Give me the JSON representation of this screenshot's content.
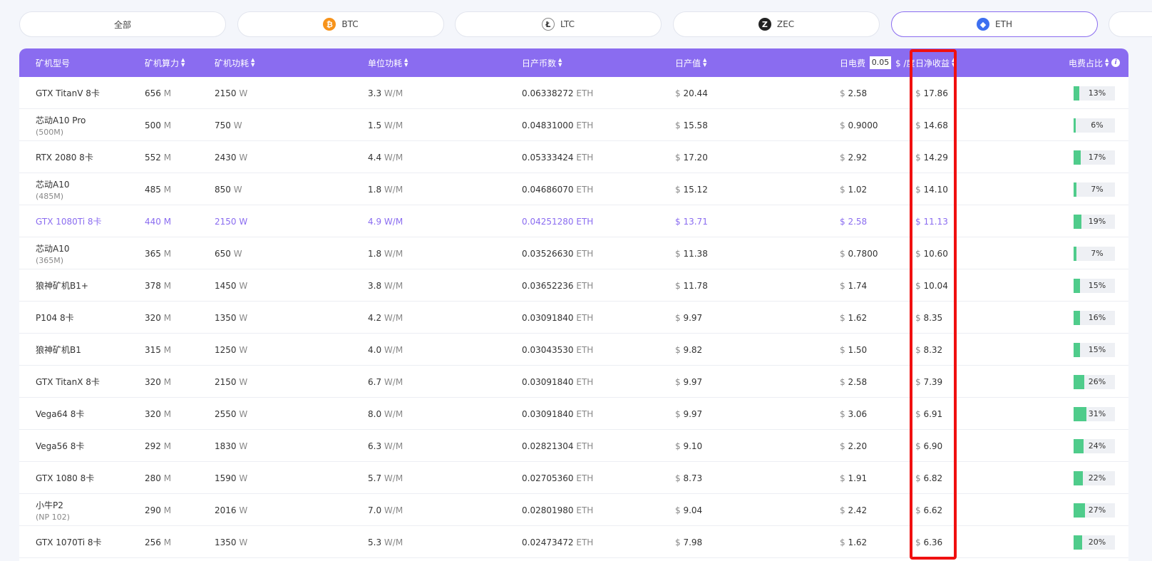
{
  "tabs": [
    {
      "label": "全部",
      "icon": null,
      "icon_glyph": ""
    },
    {
      "label": "BTC",
      "icon": "btc-icon",
      "icon_glyph": "₿"
    },
    {
      "label": "LTC",
      "icon": "ltc-icon",
      "icon_glyph": "Ł"
    },
    {
      "label": "ZEC",
      "icon": "zec-icon",
      "icon_glyph": "Z"
    },
    {
      "label": "ETH",
      "icon": "eth-icon",
      "icon_glyph": "◆"
    }
  ],
  "active_tab": "ETH",
  "header": {
    "model": "矿机型号",
    "hashrate": "矿机算力",
    "power": "矿机功耗",
    "efficiency": "单位功耗",
    "daily_coins": "日产币数",
    "daily_value": "日产值",
    "fee_label": "日电费",
    "fee_value": "0.05",
    "fee_unit": "$ /度",
    "net_income": "日净收益",
    "fee_ratio": "电费占比"
  },
  "colors": {
    "accent": "#8a6cf0",
    "bar": "#4fcc8b",
    "highlight_box": "#f01010"
  },
  "rows": [
    {
      "model": "GTX TitanV 8卡",
      "sub": "",
      "hash": "656",
      "hash_unit": "M",
      "power": "2150",
      "power_unit": "W",
      "eff": "3.3",
      "eff_unit": "W/M",
      "coins": "0.06338272",
      "coin_unit": "ETH",
      "value": "20.44",
      "fee": "2.58",
      "net": "17.86",
      "ratio": 13
    },
    {
      "model": "芯动A10 Pro",
      "sub": "(500M)",
      "hash": "500",
      "hash_unit": "M",
      "power": "750",
      "power_unit": "W",
      "eff": "1.5",
      "eff_unit": "W/M",
      "coins": "0.04831000",
      "coin_unit": "ETH",
      "value": "15.58",
      "fee": "0.9000",
      "net": "14.68",
      "ratio": 6
    },
    {
      "model": "RTX 2080 8卡",
      "sub": "",
      "hash": "552",
      "hash_unit": "M",
      "power": "2430",
      "power_unit": "W",
      "eff": "4.4",
      "eff_unit": "W/M",
      "coins": "0.05333424",
      "coin_unit": "ETH",
      "value": "17.20",
      "fee": "2.92",
      "net": "14.29",
      "ratio": 17
    },
    {
      "model": "芯动A10",
      "sub": "(485M)",
      "hash": "485",
      "hash_unit": "M",
      "power": "850",
      "power_unit": "W",
      "eff": "1.8",
      "eff_unit": "W/M",
      "coins": "0.04686070",
      "coin_unit": "ETH",
      "value": "15.12",
      "fee": "1.02",
      "net": "14.10",
      "ratio": 7
    },
    {
      "model": "GTX 1080Ti 8卡",
      "sub": "",
      "hash": "440",
      "hash_unit": "M",
      "power": "2150",
      "power_unit": "W",
      "eff": "4.9",
      "eff_unit": "W/M",
      "coins": "0.04251280",
      "coin_unit": "ETH",
      "value": "13.71",
      "fee": "2.58",
      "net": "11.13",
      "ratio": 19,
      "highlight": true
    },
    {
      "model": "芯动A10",
      "sub": "(365M)",
      "hash": "365",
      "hash_unit": "M",
      "power": "650",
      "power_unit": "W",
      "eff": "1.8",
      "eff_unit": "W/M",
      "coins": "0.03526630",
      "coin_unit": "ETH",
      "value": "11.38",
      "fee": "0.7800",
      "net": "10.60",
      "ratio": 7
    },
    {
      "model": "狼神矿机B1+",
      "sub": "",
      "hash": "378",
      "hash_unit": "M",
      "power": "1450",
      "power_unit": "W",
      "eff": "3.8",
      "eff_unit": "W/M",
      "coins": "0.03652236",
      "coin_unit": "ETH",
      "value": "11.78",
      "fee": "1.74",
      "net": "10.04",
      "ratio": 15
    },
    {
      "model": "P104 8卡",
      "sub": "",
      "hash": "320",
      "hash_unit": "M",
      "power": "1350",
      "power_unit": "W",
      "eff": "4.2",
      "eff_unit": "W/M",
      "coins": "0.03091840",
      "coin_unit": "ETH",
      "value": "9.97",
      "fee": "1.62",
      "net": "8.35",
      "ratio": 16
    },
    {
      "model": "狼神矿机B1",
      "sub": "",
      "hash": "315",
      "hash_unit": "M",
      "power": "1250",
      "power_unit": "W",
      "eff": "4.0",
      "eff_unit": "W/M",
      "coins": "0.03043530",
      "coin_unit": "ETH",
      "value": "9.82",
      "fee": "1.50",
      "net": "8.32",
      "ratio": 15
    },
    {
      "model": "GTX TitanX 8卡",
      "sub": "",
      "hash": "320",
      "hash_unit": "M",
      "power": "2150",
      "power_unit": "W",
      "eff": "6.7",
      "eff_unit": "W/M",
      "coins": "0.03091840",
      "coin_unit": "ETH",
      "value": "9.97",
      "fee": "2.58",
      "net": "7.39",
      "ratio": 26
    },
    {
      "model": "Vega64 8卡",
      "sub": "",
      "hash": "320",
      "hash_unit": "M",
      "power": "2550",
      "power_unit": "W",
      "eff": "8.0",
      "eff_unit": "W/M",
      "coins": "0.03091840",
      "coin_unit": "ETH",
      "value": "9.97",
      "fee": "3.06",
      "net": "6.91",
      "ratio": 31
    },
    {
      "model": "Vega56 8卡",
      "sub": "",
      "hash": "292",
      "hash_unit": "M",
      "power": "1830",
      "power_unit": "W",
      "eff": "6.3",
      "eff_unit": "W/M",
      "coins": "0.02821304",
      "coin_unit": "ETH",
      "value": "9.10",
      "fee": "2.20",
      "net": "6.90",
      "ratio": 24
    },
    {
      "model": "GTX 1080 8卡",
      "sub": "",
      "hash": "280",
      "hash_unit": "M",
      "power": "1590",
      "power_unit": "W",
      "eff": "5.7",
      "eff_unit": "W/M",
      "coins": "0.02705360",
      "coin_unit": "ETH",
      "value": "8.73",
      "fee": "1.91",
      "net": "6.82",
      "ratio": 22
    },
    {
      "model": "小牛P2",
      "sub": "(NP 102)",
      "hash": "290",
      "hash_unit": "M",
      "power": "2016",
      "power_unit": "W",
      "eff": "7.0",
      "eff_unit": "W/M",
      "coins": "0.02801980",
      "coin_unit": "ETH",
      "value": "9.04",
      "fee": "2.42",
      "net": "6.62",
      "ratio": 27
    },
    {
      "model": "GTX 1070Ti 8卡",
      "sub": "",
      "hash": "256",
      "hash_unit": "M",
      "power": "1350",
      "power_unit": "W",
      "eff": "5.3",
      "eff_unit": "W/M",
      "coins": "0.02473472",
      "coin_unit": "ETH",
      "value": "7.98",
      "fee": "1.62",
      "net": "6.36",
      "ratio": 20
    }
  ]
}
